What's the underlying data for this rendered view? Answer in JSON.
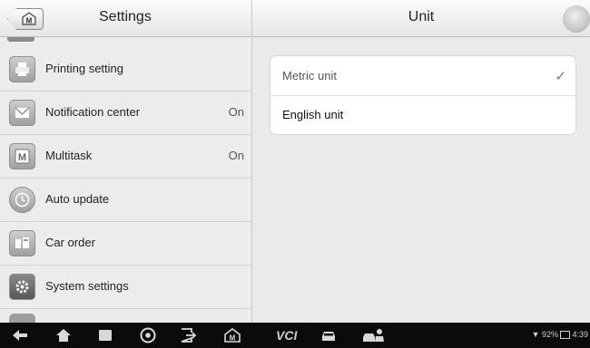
{
  "left": {
    "title": "Settings",
    "items": [
      {
        "label": "Printing setting",
        "value": ""
      },
      {
        "label": "Notification center",
        "value": "On"
      },
      {
        "label": "Multitask",
        "value": "On"
      },
      {
        "label": "Auto update",
        "value": ""
      },
      {
        "label": "Car order",
        "value": ""
      },
      {
        "label": "System settings",
        "value": ""
      }
    ]
  },
  "right": {
    "title": "Unit",
    "options": [
      {
        "label": "Metric unit",
        "selected": true,
        "check": "✓"
      },
      {
        "label": "English unit",
        "selected": false
      }
    ]
  },
  "navbar": {
    "vcl_label": "VCI",
    "battery": "92%",
    "time": "4:39"
  },
  "icons": [
    "home-m-icon",
    "printer-icon",
    "mail-icon",
    "multitask-m-icon",
    "clock-icon",
    "car-order-icon",
    "gear-icon",
    "back-icon",
    "home-icon",
    "recent-apps-icon",
    "chrome-icon",
    "exit-app-icon",
    "car-icon",
    "car-person-icon",
    "wifi-icon"
  ]
}
